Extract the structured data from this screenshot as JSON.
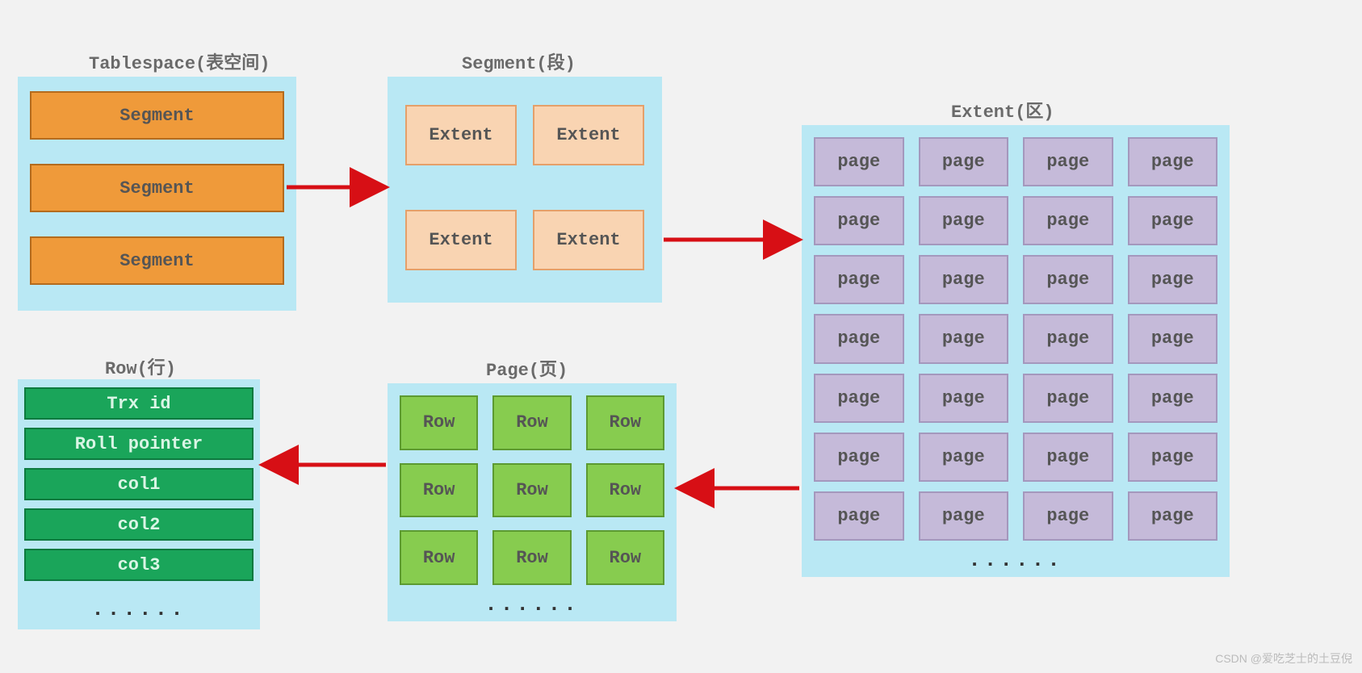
{
  "tablespace": {
    "title": "Tablespace(表空间)",
    "items": [
      "Segment",
      "Segment",
      "Segment"
    ]
  },
  "segment": {
    "title": "Segment(段)",
    "items": [
      "Extent",
      "Extent",
      "Extent",
      "Extent"
    ]
  },
  "extent": {
    "title": "Extent(区)",
    "item_label": "page",
    "rows": 7,
    "cols": 4,
    "dots": "......"
  },
  "page": {
    "title": "Page(页)",
    "item_label": "Row",
    "rows": 3,
    "cols": 3,
    "dots": "......"
  },
  "row": {
    "title": "Row(行)",
    "items": [
      "Trx id",
      "Roll pointer",
      "col1",
      "col2",
      "col3"
    ],
    "dots": "......"
  },
  "watermark": "CSDN @爱吃芝士的土豆倪"
}
